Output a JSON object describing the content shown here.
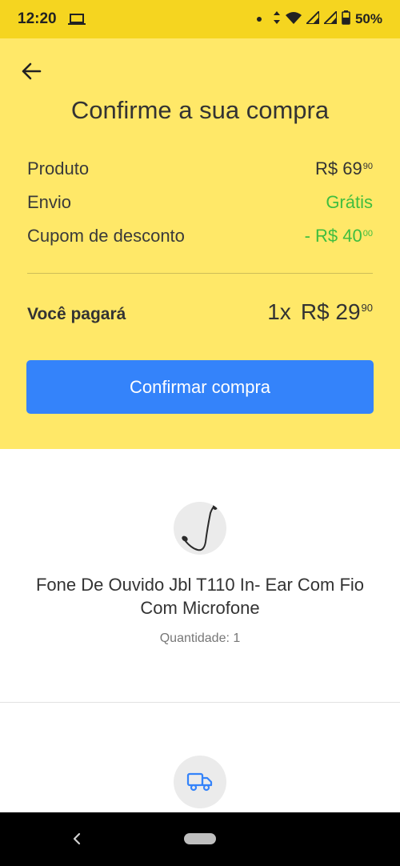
{
  "status_bar": {
    "time": "12:20",
    "battery": "50%",
    "icons": [
      "laptop-icon",
      "dot-icon",
      "data-arrows-icon",
      "wifi-icon",
      "signal-icon",
      "signal-icon",
      "battery-icon"
    ]
  },
  "header": {
    "title": "Confirme a sua compra",
    "back_icon": "arrow-left-icon"
  },
  "summary": {
    "product": {
      "label": "Produto",
      "value_main": "R$ 69",
      "value_cents": "90"
    },
    "shipping": {
      "label": "Envio",
      "value": "Grátis"
    },
    "coupon": {
      "label": "Cupom de desconto",
      "value_main": "- R$ 40",
      "value_cents": "00"
    }
  },
  "total": {
    "label": "Você pagará",
    "installments": "1x",
    "value_main": "R$ 29",
    "value_cents": "90"
  },
  "confirm_button": {
    "label": "Confirmar compra"
  },
  "product": {
    "name": "Fone De Ouvido Jbl T110 In- Ear Com Fio Com Microfone",
    "quantity": "Quantidade: 1"
  },
  "shipping_section": {
    "icon": "truck-icon"
  },
  "colors": {
    "status_bar": "#f5d520",
    "header_bg": "#ffe868",
    "primary_button": "#3483fa",
    "free_green": "#3fbe3f"
  }
}
